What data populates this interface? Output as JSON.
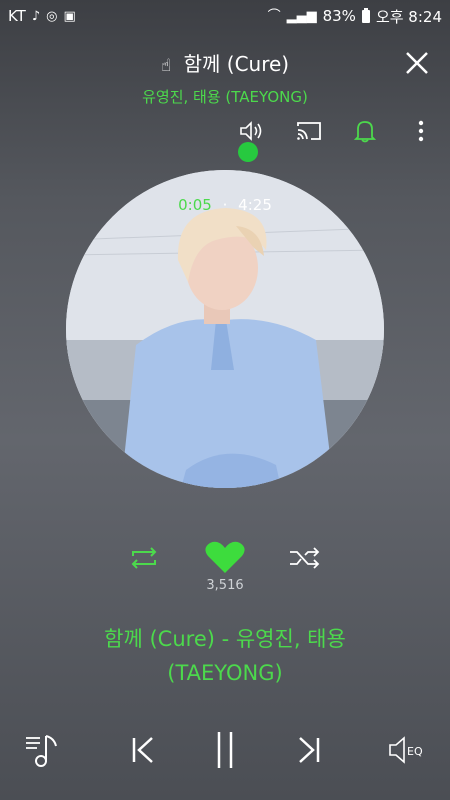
{
  "status_bar": {
    "carrier": "KT",
    "battery": "83%",
    "time_label": "오후 8:24"
  },
  "header": {
    "title": "함께 (Cure)",
    "artist": "유영진, 태용 (TAEYONG)"
  },
  "playback": {
    "current_time": "0:05",
    "separator": "·",
    "total_time": "4:25",
    "progress": 0.019
  },
  "actions": {
    "like_count": "3,516"
  },
  "song_line": {
    "line1": "함께 (Cure) - 유영진, 태용",
    "line2": "(TAEYONG)"
  },
  "icons": {
    "close": "close-icon",
    "speaker": "speaker-icon",
    "cast": "cast-icon",
    "alarm": "bell-icon",
    "menu": "more-vert-icon",
    "repeat": "repeat-icon",
    "like": "heart-icon",
    "shuffle": "shuffle-icon",
    "playlist": "playlist-icon",
    "prev": "previous-icon",
    "pause": "pause-icon",
    "next": "next-icon",
    "eq": "eq-icon"
  },
  "colors": {
    "accent": "#4cd94c"
  }
}
